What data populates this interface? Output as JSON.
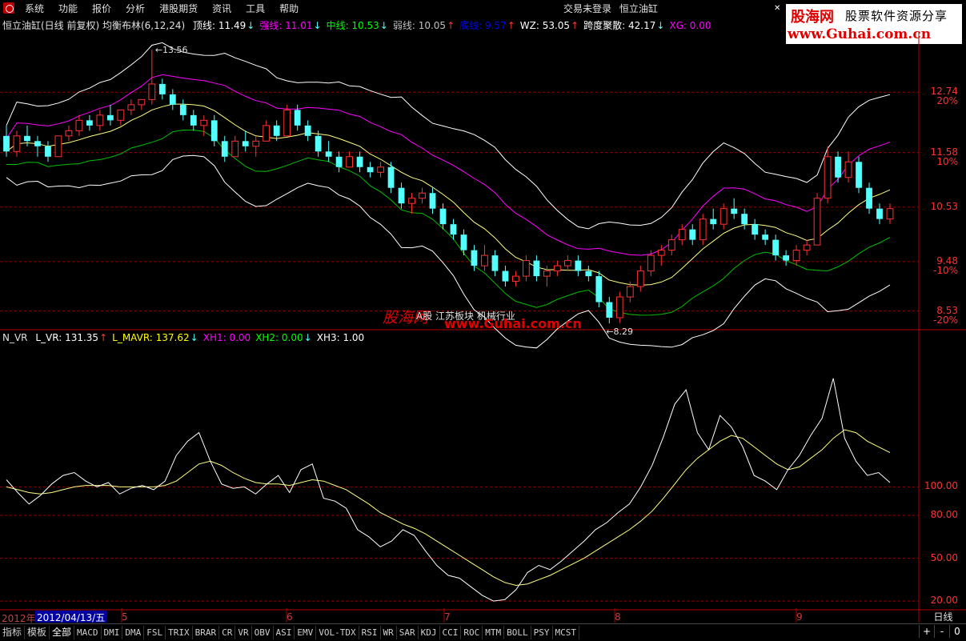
{
  "menubar": {
    "items": [
      "系统",
      "功能",
      "报价",
      "分析",
      "港股期货",
      "资讯",
      "工具",
      "帮助"
    ],
    "login_status": "交易未登录",
    "stock_name": "恒立油缸"
  },
  "ad": {
    "logo": "股海网",
    "slogan": "股票软件资源分享",
    "url": "www.Guhai.com.cn"
  },
  "main_panel": {
    "title": "恒立油缸(日线 前复权) 均衡布林(6,12,24)",
    "indicators": [
      {
        "name": "顶线",
        "value": "11.49",
        "dir": "down",
        "color": "#ffffff"
      },
      {
        "name": "强线",
        "value": "11.01",
        "dir": "down",
        "color": "#ff00ff"
      },
      {
        "name": "中线",
        "value": "10.53",
        "dir": "down",
        "color": "#00ff00"
      },
      {
        "name": "弱线",
        "value": "10.05",
        "dir": "up",
        "color": "#c0c0c0"
      },
      {
        "name": "底线",
        "value": "9.57",
        "dir": "up",
        "color": "#0000ff"
      },
      {
        "name": "WZ",
        "value": "53.05",
        "dir": "up",
        "color": "#ffffff"
      },
      {
        "name": "跨度聚散",
        "value": "42.17",
        "dir": "down",
        "color": "#ffffff"
      },
      {
        "name": "XG",
        "value": "0.00",
        "dir": "",
        "color": "#ff00ff"
      }
    ],
    "high_label": "13.56",
    "low_label": "8.29",
    "price_axis": [
      {
        "price": "12.74",
        "pct": "20%"
      },
      {
        "price": "11.58",
        "pct": "10%"
      },
      {
        "price": "10.53",
        "pct": ""
      },
      {
        "price": "9.48",
        "pct": "-10%"
      },
      {
        "price": "8.53",
        "pct": "-20%"
      }
    ],
    "watermark": {
      "logo": "股海网",
      "sub": "A股   江苏板块   机械行业",
      "url": "www.Guhai.com.cn"
    }
  },
  "sub_panel": {
    "title": "N_VR",
    "indicators": [
      {
        "name": "L_VR",
        "value": "131.35",
        "dir": "up",
        "color": "#ffffff"
      },
      {
        "name": "L_MAVR",
        "value": "137.62",
        "dir": "down",
        "color": "#ffff00"
      },
      {
        "name": "XH1",
        "value": "0.00",
        "dir": "",
        "color": "#ff00ff"
      },
      {
        "name": "XH2",
        "value": "0.00",
        "dir": "down",
        "color": "#00ff00"
      },
      {
        "name": "XH3",
        "value": "1.00",
        "dir": "",
        "color": "#ffffff"
      }
    ],
    "axis": [
      "100.00",
      "80.00",
      "50.00",
      "20.00"
    ]
  },
  "date_axis": {
    "year_label": "2012年",
    "cursor_date": "2012/04/13/五",
    "months": [
      "5",
      "6",
      "7",
      "8",
      "9"
    ],
    "period": "日线"
  },
  "tabs": {
    "categories": [
      "指标",
      "模板",
      "全部"
    ],
    "indicators": [
      "MACD",
      "DMI",
      "DMA",
      "FSL",
      "TRIX",
      "BRAR",
      "CR",
      "VR",
      "OBV",
      "ASI",
      "EMV",
      "VOL-TDX",
      "RSI",
      "WR",
      "SAR",
      "KDJ",
      "CCI",
      "ROC",
      "MTM",
      "BOLL",
      "PSY",
      "MCST"
    ]
  },
  "zoom": {
    "plus": "+",
    "minus": "-",
    "zero": "0"
  },
  "colors": {
    "up": "#ff3232",
    "down": "#54ffff",
    "grid": "#900000",
    "accent": "#ff0000"
  },
  "chart_data": {
    "type": "candlestick",
    "ylim": [
      8.2,
      13.9
    ],
    "candles": [
      [
        11.9,
        12.1,
        11.5,
        11.6
      ],
      [
        11.6,
        12.0,
        11.5,
        11.9
      ],
      [
        11.9,
        12.1,
        11.7,
        11.8
      ],
      [
        11.8,
        11.9,
        11.5,
        11.7
      ],
      [
        11.7,
        11.8,
        11.4,
        11.5
      ],
      [
        11.5,
        11.9,
        11.5,
        11.9
      ],
      [
        11.9,
        12.1,
        11.8,
        12.0
      ],
      [
        12.0,
        12.3,
        11.9,
        12.2
      ],
      [
        12.2,
        12.3,
        12.0,
        12.1
      ],
      [
        12.1,
        12.4,
        12.0,
        12.3
      ],
      [
        12.3,
        12.5,
        12.1,
        12.2
      ],
      [
        12.2,
        12.4,
        12.1,
        12.4
      ],
      [
        12.4,
        12.6,
        12.3,
        12.5
      ],
      [
        12.5,
        12.6,
        12.4,
        12.6
      ],
      [
        12.6,
        13.56,
        12.5,
        12.9
      ],
      [
        12.9,
        13.0,
        12.6,
        12.7
      ],
      [
        12.7,
        12.8,
        12.4,
        12.5
      ],
      [
        12.5,
        12.6,
        12.2,
        12.3
      ],
      [
        12.3,
        12.4,
        12.0,
        12.1
      ],
      [
        12.1,
        12.3,
        11.9,
        12.2
      ],
      [
        12.2,
        12.3,
        11.7,
        11.8
      ],
      [
        11.8,
        11.9,
        11.4,
        11.5
      ],
      [
        11.5,
        11.9,
        11.5,
        11.8
      ],
      [
        11.8,
        12.0,
        11.6,
        11.7
      ],
      [
        11.7,
        11.9,
        11.5,
        11.8
      ],
      [
        11.8,
        12.2,
        11.8,
        12.1
      ],
      [
        12.1,
        12.2,
        11.8,
        11.9
      ],
      [
        11.9,
        12.5,
        11.9,
        12.4
      ],
      [
        12.4,
        12.5,
        12.0,
        12.1
      ],
      [
        12.1,
        12.2,
        11.8,
        11.9
      ],
      [
        11.9,
        12.0,
        11.5,
        11.6
      ],
      [
        11.6,
        11.8,
        11.4,
        11.5
      ],
      [
        11.5,
        11.6,
        11.2,
        11.3
      ],
      [
        11.3,
        11.6,
        11.3,
        11.5
      ],
      [
        11.5,
        11.6,
        11.2,
        11.3
      ],
      [
        11.3,
        11.4,
        11.1,
        11.2
      ],
      [
        11.2,
        11.4,
        11.1,
        11.3
      ],
      [
        11.3,
        11.4,
        10.8,
        10.9
      ],
      [
        10.9,
        11.0,
        10.5,
        10.6
      ],
      [
        10.6,
        10.8,
        10.4,
        10.7
      ],
      [
        10.7,
        10.9,
        10.6,
        10.8
      ],
      [
        10.8,
        10.9,
        10.4,
        10.5
      ],
      [
        10.5,
        10.6,
        10.1,
        10.2
      ],
      [
        10.2,
        10.3,
        9.9,
        10.0
      ],
      [
        10.0,
        10.1,
        9.6,
        9.7
      ],
      [
        9.7,
        9.8,
        9.3,
        9.4
      ],
      [
        9.4,
        9.8,
        9.3,
        9.6
      ],
      [
        9.6,
        9.7,
        9.2,
        9.3
      ],
      [
        9.3,
        9.4,
        9.0,
        9.1
      ],
      [
        9.1,
        9.3,
        9.0,
        9.2
      ],
      [
        9.2,
        9.6,
        9.1,
        9.5
      ],
      [
        9.5,
        9.6,
        9.1,
        9.2
      ],
      [
        9.2,
        9.4,
        9.0,
        9.3
      ],
      [
        9.3,
        9.5,
        9.2,
        9.4
      ],
      [
        9.4,
        9.6,
        9.3,
        9.5
      ],
      [
        9.5,
        9.6,
        9.2,
        9.3
      ],
      [
        9.3,
        9.4,
        9.1,
        9.2
      ],
      [
        9.2,
        9.3,
        8.6,
        8.7
      ],
      [
        8.7,
        8.8,
        8.29,
        8.4
      ],
      [
        8.4,
        8.9,
        8.3,
        8.8
      ],
      [
        8.8,
        9.1,
        8.7,
        9.0
      ],
      [
        9.0,
        9.4,
        8.9,
        9.3
      ],
      [
        9.3,
        9.7,
        9.2,
        9.6
      ],
      [
        9.6,
        9.8,
        9.4,
        9.7
      ],
      [
        9.7,
        10.0,
        9.6,
        9.9
      ],
      [
        9.9,
        10.2,
        9.8,
        10.1
      ],
      [
        10.1,
        10.2,
        9.8,
        9.9
      ],
      [
        9.9,
        10.4,
        9.8,
        10.3
      ],
      [
        10.3,
        10.5,
        10.1,
        10.2
      ],
      [
        10.2,
        10.6,
        10.1,
        10.5
      ],
      [
        10.5,
        10.7,
        10.3,
        10.4
      ],
      [
        10.4,
        10.5,
        10.1,
        10.2
      ],
      [
        10.2,
        10.3,
        9.9,
        10.0
      ],
      [
        10.0,
        10.1,
        9.8,
        9.9
      ],
      [
        9.9,
        10.0,
        9.5,
        9.6
      ],
      [
        9.6,
        9.7,
        9.4,
        9.5
      ],
      [
        9.5,
        9.8,
        9.4,
        9.7
      ],
      [
        9.7,
        9.9,
        9.6,
        9.8
      ],
      [
        9.8,
        10.8,
        9.8,
        10.7
      ],
      [
        10.7,
        11.7,
        10.6,
        11.5
      ],
      [
        11.5,
        11.6,
        11.0,
        11.1
      ],
      [
        11.1,
        11.6,
        11.0,
        11.4
      ],
      [
        11.4,
        11.5,
        10.8,
        10.9
      ],
      [
        10.9,
        11.0,
        10.4,
        10.5
      ],
      [
        10.5,
        10.6,
        10.2,
        10.3
      ],
      [
        10.3,
        10.6,
        10.2,
        10.5
      ]
    ],
    "vr": [
      105,
      96,
      88,
      94,
      102,
      108,
      110,
      104,
      100,
      103,
      95,
      99,
      101,
      98,
      104,
      122,
      132,
      138,
      118,
      102,
      99,
      100,
      95,
      102,
      108,
      96,
      112,
      116,
      92,
      90,
      85,
      70,
      65,
      58,
      62,
      70,
      66,
      55,
      45,
      38,
      36,
      30,
      24,
      20,
      21,
      28,
      40,
      45,
      42,
      48,
      55,
      62,
      70,
      75,
      82,
      88,
      100,
      115,
      135,
      158,
      168,
      138,
      126,
      150,
      142,
      128,
      108,
      104,
      98,
      112,
      122,
      136,
      148,
      176,
      134,
      118,
      108,
      110,
      103
    ],
    "mavr": [
      100,
      98,
      96,
      95,
      96,
      98,
      100,
      101,
      101,
      101,
      100,
      100,
      100,
      100,
      101,
      104,
      110,
      116,
      118,
      115,
      110,
      106,
      103,
      102,
      102,
      101,
      103,
      105,
      104,
      101,
      98,
      93,
      88,
      82,
      78,
      74,
      71,
      67,
      62,
      57,
      52,
      47,
      42,
      37,
      33,
      31,
      32,
      35,
      38,
      42,
      46,
      50,
      55,
      60,
      65,
      70,
      76,
      83,
      92,
      102,
      112,
      120,
      126,
      132,
      136,
      134,
      128,
      122,
      116,
      112,
      114,
      120,
      126,
      134,
      140,
      138,
      132,
      128,
      124
    ]
  }
}
